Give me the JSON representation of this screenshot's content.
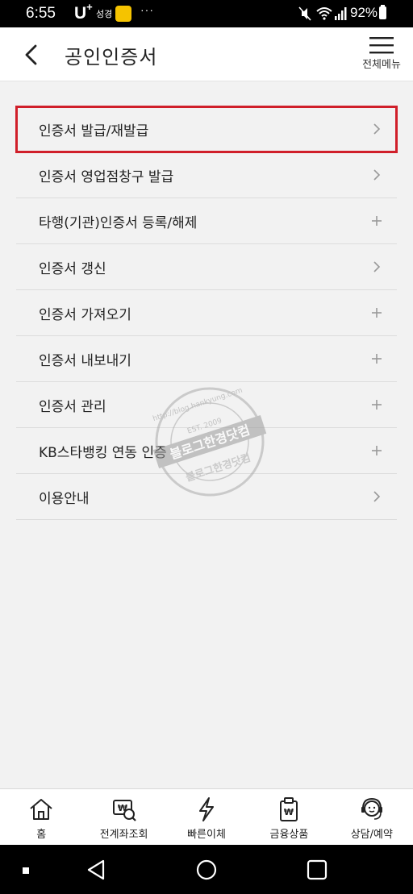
{
  "status_bar": {
    "time": "6:55",
    "carrier": "U",
    "carrier_sup": "+",
    "signal_text": "성경",
    "more": "···",
    "battery": "92%"
  },
  "header": {
    "title": "공인인증서",
    "menu_label": "전체메뉴"
  },
  "menu": {
    "items": [
      {
        "label": "인증서 발급/재발급",
        "action": "chevron",
        "highlighted": true
      },
      {
        "label": "인증서 영업점창구 발급",
        "action": "chevron"
      },
      {
        "label": "타행(기관)인증서 등록/해제",
        "action": "plus"
      },
      {
        "label": "인증서 갱신",
        "action": "chevron"
      },
      {
        "label": "인증서 가져오기",
        "action": "plus"
      },
      {
        "label": "인증서 내보내기",
        "action": "plus"
      },
      {
        "label": "인증서 관리",
        "action": "plus"
      },
      {
        "label": "KB스타뱅킹 연동 인증",
        "action": "plus"
      },
      {
        "label": "이용안내",
        "action": "chevron"
      }
    ]
  },
  "watermark": {
    "text": "블로그한경닷컴",
    "url": "http://blog.hankyung.com",
    "est": "EST. 2009"
  },
  "bottom_nav": {
    "items": [
      {
        "label": "홈",
        "icon": "home-icon"
      },
      {
        "label": "전계좌조회",
        "icon": "account-search-icon"
      },
      {
        "label": "빠른이체",
        "icon": "lightning-icon"
      },
      {
        "label": "금융상품",
        "icon": "product-icon"
      },
      {
        "label": "상담/예약",
        "icon": "consult-icon"
      }
    ]
  },
  "colors": {
    "highlight_border": "#d01f2a",
    "background": "#f2f2f2",
    "icon_gray": "#999999"
  }
}
